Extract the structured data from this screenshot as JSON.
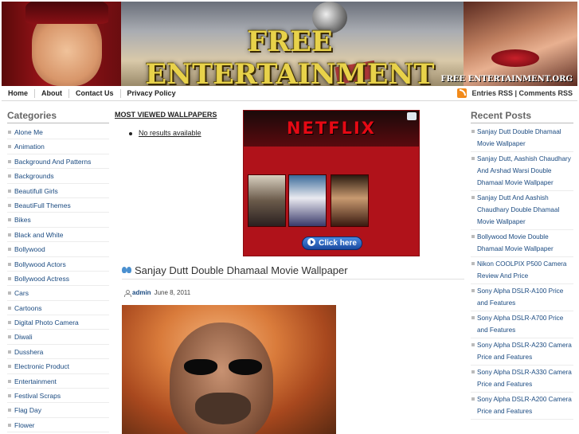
{
  "header": {
    "title": "FREE ENTERTAINMENT",
    "site_mark": "FREE ENTERTAINMENT.ORG"
  },
  "nav": {
    "items": [
      "Home",
      "About",
      "Contact Us",
      "Privacy Policy"
    ],
    "rss": "Entries RSS | Comments RSS"
  },
  "left_sidebar": {
    "title": "Categories",
    "items": [
      "Alone Me",
      "Animation",
      "Background And Patterns",
      "Backgrounds",
      "Beautifull Girls",
      "BeautiFull Themes",
      "Bikes",
      "Black and White",
      "Bollywood",
      "Bollywood Actors",
      "Bollywood Actress",
      "Cars",
      "Cartoons",
      "Digital Photo Camera",
      "Diwali",
      "Dusshera",
      "Electronic Product",
      "Entertainment",
      "Festival Scraps",
      "Flag Day",
      "Flower"
    ]
  },
  "most_viewed": {
    "title": "MOST VIEWED WALLPAPERS",
    "empty": "No results available"
  },
  "ad": {
    "brand": "NETFLIX",
    "cta": "Click here"
  },
  "post": {
    "title": "Sanjay Dutt Double Dhamaal Movie Wallpaper",
    "author": "admin",
    "date": "June 8, 2011"
  },
  "right_sidebar": {
    "title": "Recent Posts",
    "items": [
      "Sanjay Dutt Double Dhamaal Movie Wallpaper",
      "Sanjay Dutt, Aashish Chaudhary And Arshad Warsi Double Dhamaal Movie Wallpaper",
      "Sanjay Dutt And Aashish Chaudhary Double Dhamaal Movie Wallpaper",
      "Bollywood Movie Double Dhamaal Movie Wallpaper",
      "Nikon COOLPIX P500 Camera Review And Price",
      "Sony Alpha DSLR-A100 Price and Features",
      "Sony Alpha DSLR-A700 Price and Features",
      "Sony Alpha DSLR-A230 Camera Price and Features",
      "Sony Alpha DSLR-A330 Camera Price and Features",
      "Sony Alpha DSLR-A200 Camera Price and Features"
    ]
  }
}
